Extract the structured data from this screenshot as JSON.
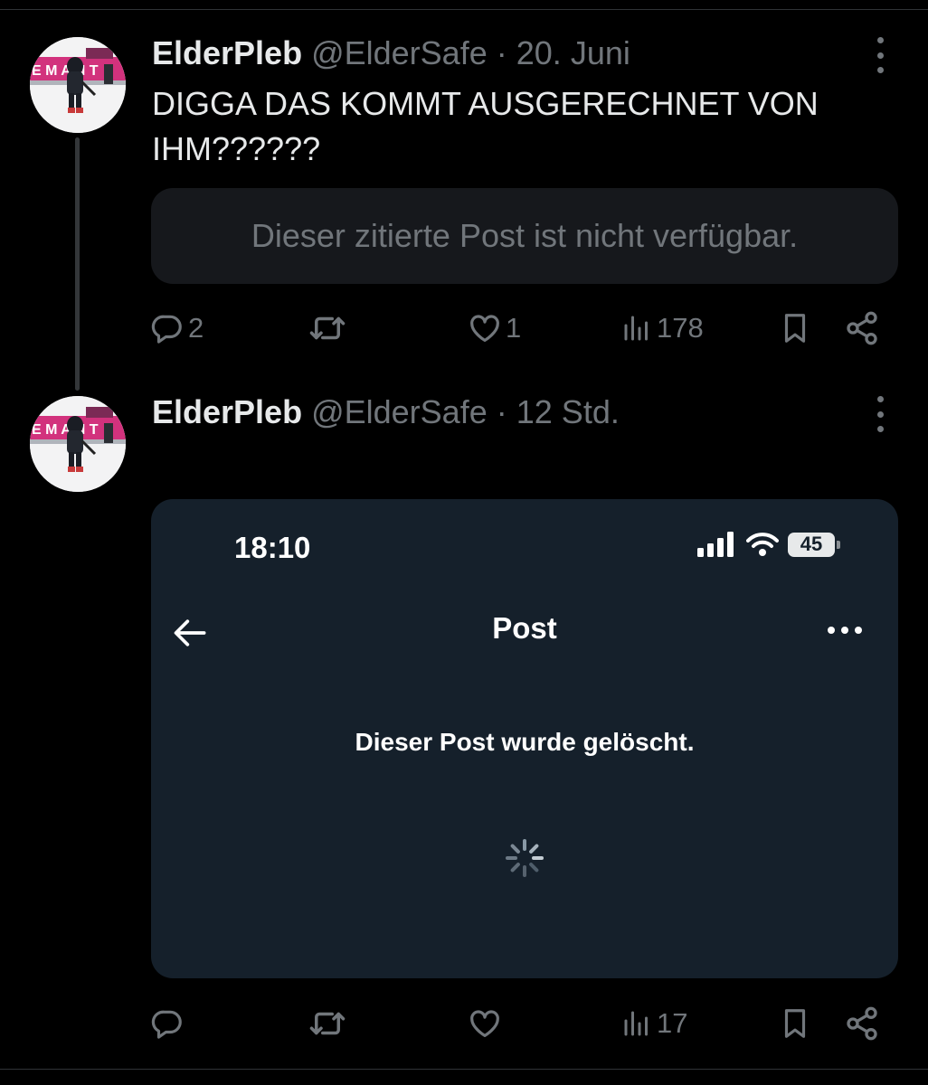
{
  "tweets": [
    {
      "display_name": "ElderPleb",
      "handle": "@ElderSafe",
      "separator": "·",
      "time": "20. Juni",
      "text": "DIGGA DAS KOMMT AUSGERECHNET VON IHM??????",
      "quote_unavailable": "Dieser zitierte Post ist nicht verfügbar.",
      "actions": {
        "replies": "2",
        "reposts": "",
        "likes": "1",
        "views": "178"
      }
    },
    {
      "display_name": "ElderPleb",
      "handle": "@ElderSafe",
      "separator": "·",
      "time": "12 Std.",
      "media": {
        "status_time": "18:10",
        "battery": "45",
        "page_title": "Post",
        "message": "Dieser Post wurde gelöscht."
      },
      "actions": {
        "replies": "",
        "reposts": "",
        "likes": "",
        "views": "17"
      }
    }
  ],
  "colors": {
    "background": "#000000",
    "text_primary": "#e7e9ea",
    "text_muted": "#71767b",
    "quote_bg": "#16181c",
    "media_bg": "#15202b"
  },
  "icons": {
    "reply": "reply-icon",
    "repost": "repost-icon",
    "like": "heart-icon",
    "views": "views-chart-icon",
    "bookmark": "bookmark-icon",
    "share": "share-icon",
    "more": "more-vertical-icon"
  }
}
